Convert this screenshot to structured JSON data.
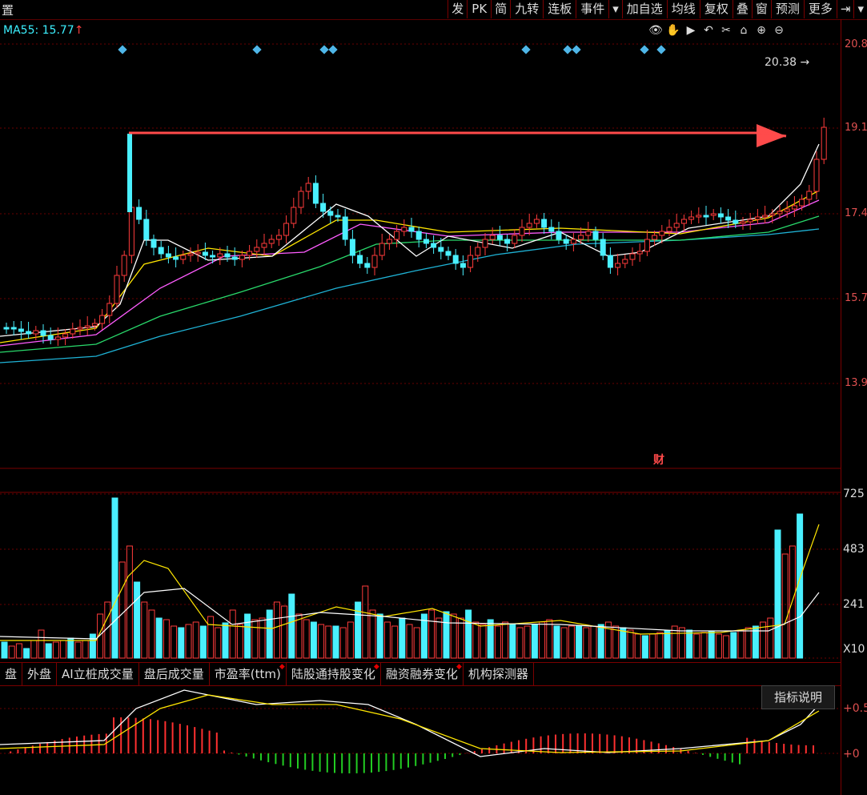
{
  "toolbar": {
    "left_label": "置",
    "buttons": [
      "发",
      "PK",
      "简",
      "九转",
      "连板",
      "事件",
      "▾",
      "加自选",
      "均线",
      "复权",
      "叠",
      "窗",
      "预测",
      "更多",
      "⇥",
      "▾"
    ]
  },
  "ma_label": "MA55: 15.77",
  "ma_arrow": "↑",
  "price_axis": [
    "20.8",
    "19.1",
    "17.4",
    "15.7",
    "13.9"
  ],
  "price_tag": "20.38",
  "cai_label": "财",
  "volume_axis": [
    "725",
    "483",
    "241",
    "X10"
  ],
  "indicator_axis": [
    "+0.5",
    "+0"
  ],
  "tabs": [
    {
      "label": "盘",
      "dot": false
    },
    {
      "label": "外盘",
      "dot": false
    },
    {
      "label": "AI立桩成交量",
      "dot": false
    },
    {
      "label": "盘后成交量",
      "dot": false
    },
    {
      "label": "市盈率(ttm)",
      "dot": true
    },
    {
      "label": "陆股通持股变化",
      "dot": true
    },
    {
      "label": "融资融券变化",
      "dot": true
    },
    {
      "label": "机构探测器",
      "dot": false
    }
  ],
  "indicator_button": "指标说明",
  "colors": {
    "up": "#ff3b3b",
    "down": "#4af0ff",
    "ma_white": "#ffffff",
    "ma_yellow": "#ffe600",
    "ma_magenta": "#ff5cff",
    "ma_green": "#29d96b",
    "ma_cyan": "#1fb3d6",
    "arrow": "#ff4b4b"
  },
  "icons": [
    "eye-icon",
    "hand-icon",
    "play-icon",
    "undo-icon",
    "scissors-icon",
    "lock-icon",
    "zoom-in-icon",
    "zoom-out-icon"
  ]
}
